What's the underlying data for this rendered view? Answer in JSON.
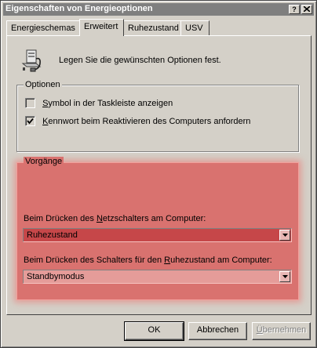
{
  "window": {
    "title": "Eigenschaften von Energieoptionen",
    "help_button": "?",
    "close_button": "X"
  },
  "tabs": [
    {
      "label": "Energieschemas",
      "active": false
    },
    {
      "label": "Erweitert",
      "active": true
    },
    {
      "label": "Ruhezustand",
      "active": false
    },
    {
      "label": "USV",
      "active": false
    }
  ],
  "intro": {
    "icon": "power-computer-icon",
    "text": "Legen Sie die gewünschten Optionen fest."
  },
  "options": {
    "group_label": "Optionen",
    "items": [
      {
        "label_mn": "S",
        "label_rest": "ymbol in der Taskleiste anzeigen",
        "checked": false
      },
      {
        "label_mn": "K",
        "label_rest": "ennwort beim Reaktivieren des Computers anfordern",
        "checked": true
      }
    ]
  },
  "actions": {
    "group_label": "Vorgänge",
    "highlight_color": "#d9726f",
    "power_button": {
      "label_pre": "Beim Drücken des ",
      "label_mn": "N",
      "label_post": "etzschalters am Computer:",
      "value": "Ruhezustand"
    },
    "sleep_button": {
      "label_pre": "Beim Drücken des Schalters für den ",
      "label_mn": "R",
      "label_post": "uhezustand am Computer:",
      "value": "Standbymodus"
    }
  },
  "buttons": {
    "ok": "OK",
    "cancel": "Abbrechen",
    "apply_mn": "Ü",
    "apply_rest": "bernehmen"
  }
}
